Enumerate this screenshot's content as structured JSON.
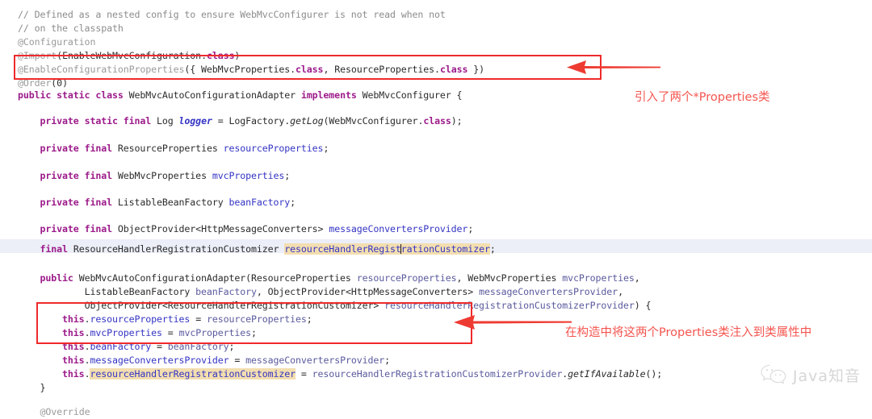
{
  "editor": {
    "language": "java",
    "background": "#ffffff",
    "current_line_highlight": "#eceef8",
    "occurrence_highlight": "#f3deb0",
    "keyword_color": "#9c1b8a",
    "field_color": "#3434c4",
    "comment_color": "#8c8c8c",
    "annotation_color": "#9a9a9a",
    "lines": [
      "// Defined as a nested config to ensure WebMvcConfigurer is not read when not",
      "// on the classpath",
      "@Configuration",
      "@Import(EnableWebMvcConfiguration.class)",
      "@EnableConfigurationProperties({ WebMvcProperties.class, ResourceProperties.class })",
      "@Order(0)",
      "public static class WebMvcAutoConfigurationAdapter implements WebMvcConfigurer {",
      "",
      "    private static final Log logger = LogFactory.getLog(WebMvcConfigurer.class);",
      "",
      "    private final ResourceProperties resourceProperties;",
      "",
      "    private final WebMvcProperties mvcProperties;",
      "",
      "    private final ListableBeanFactory beanFactory;",
      "",
      "    private final ObjectProvider<HttpMessageConverters> messageConvertersProvider;",
      "",
      "    final ResourceHandlerRegistrationCustomizer resourceHandlerRegistrationCustomizer;",
      "",
      "    public WebMvcAutoConfigurationAdapter(ResourceProperties resourceProperties, WebMvcProperties mvcProperties,",
      "            ListableBeanFactory beanFactory, ObjectProvider<HttpMessageConverters> messageConvertersProvider,",
      "            ObjectProvider<ResourceHandlerRegistrationCustomizer> resourceHandlerRegistrationCustomizerProvider) {",
      "        this.resourceProperties = resourceProperties;",
      "        this.mvcProperties = mvcProperties;",
      "        this.beanFactory = beanFactory;",
      "        this.messageConvertersProvider = messageConvertersProvider;",
      "        this.resourceHandlerRegistrationCustomizer = resourceHandlerRegistrationCustomizerProvider.getIfAvailable();",
      "    }",
      "",
      "    @Override"
    ],
    "highlighted_occurrence": "resourceHandlerRegistrationCustomizer",
    "caret_line_text": "    final ResourceHandlerRegistrationCustomizer resourceHandlerRegistrationCustomizer;"
  },
  "annotations": {
    "color": "#f4554f",
    "box_color": "#ef2a2a",
    "items": [
      {
        "id": "note-properties-imported",
        "text": "引入了两个*Properties类",
        "target": "@EnableConfigurationProperties({ WebMvcProperties.class, ResourceProperties.class })"
      },
      {
        "id": "note-constructor-injection",
        "text": "在构造中将这两个Properties类注入到类属性中",
        "target": "constructor assignments of resourceProperties and mvcProperties"
      }
    ]
  },
  "watermark": {
    "icon": "wechat-icon",
    "text": "Java知音"
  }
}
